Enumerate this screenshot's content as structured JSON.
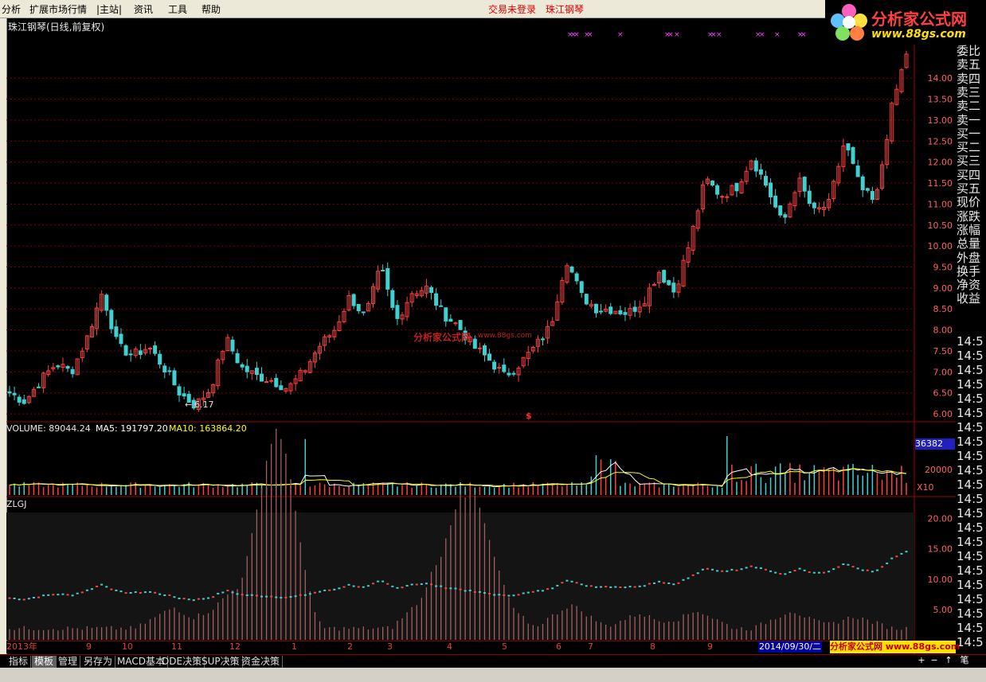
{
  "menu": {
    "items": [
      "分析",
      "扩展市场行情",
      "|主站|",
      "资讯",
      "工具",
      "帮助"
    ],
    "status_login": "交易未登录",
    "status_stock": "珠江钢琴"
  },
  "logo": {
    "text": "分析家公式网",
    "url": "www.88gs.com"
  },
  "chart_title": "珠江钢琴(日线,前复权)",
  "watermark": {
    "brand": "分析家公式网",
    "url": ".www.88gs.com"
  },
  "low_marker": "6.17",
  "signal_marker": "$",
  "volume_legend": {
    "vol_label": "VOLUME: 89044.24",
    "ma5_label": "MA5: 191797.20",
    "ma10_label": "MA10: 163864.20"
  },
  "volume_box": "36382",
  "volume_scale": "X10",
  "zlgj_label": "ZLGJ",
  "right_panel": {
    "labels": [
      "委比",
      "卖五",
      "卖四",
      "卖三",
      "卖二",
      "卖一",
      "买一",
      "买二",
      "买三",
      "买四",
      "买五",
      "现价",
      "涨跌",
      "涨幅",
      "总量",
      "外盘",
      "换手",
      "净资",
      "收益"
    ],
    "repeat_label": "14:5"
  },
  "date_axis": {
    "labels": [
      "2013年",
      "9",
      "10",
      "11",
      "12",
      "1",
      "2",
      "3",
      "4",
      "5",
      "6",
      "7",
      "8",
      "9"
    ],
    "current_date": "2014/09/30/二"
  },
  "mini_logo": "分析家公式网 www.88gs.com",
  "bottom_tabs": [
    "指标",
    "模板",
    "管理",
    "另存为",
    "MACD基本",
    "DDE决策",
    "SUP决策",
    "资金决策"
  ],
  "bottom_active": "模板",
  "nav_buttons": [
    "+",
    "−",
    "↑",
    "笔"
  ],
  "colors": {
    "up": "#ff4040",
    "down": "#40d0d0",
    "grid": "#800000",
    "axis_text": "#ff6060",
    "ma5": "#ffffff",
    "ma10": "#ffff00",
    "zlgj_bg": "#141414",
    "zlgj_bar": "#a06060"
  },
  "chart_data": [
    {
      "type": "candlestick",
      "title": "珠江钢琴(日线,前复权)",
      "y_ticks": [
        6.0,
        6.5,
        7.0,
        7.5,
        8.0,
        8.5,
        9.0,
        9.5,
        10.0,
        10.5,
        11.0,
        11.5,
        12.0,
        12.5,
        13.0,
        13.5,
        14.0
      ],
      "ylim": [
        5.85,
        14.8
      ],
      "anchor_closes": [
        6.5,
        6.3,
        6.8,
        7.2,
        7.0,
        7.8,
        8.9,
        7.6,
        7.4,
        7.6,
        7.1,
        6.5,
        6.2,
        6.6,
        7.8,
        7.1,
        6.9,
        6.8,
        6.6,
        7.0,
        7.6,
        8.0,
        8.8,
        8.3,
        9.5,
        8.2,
        8.9,
        9.0,
        8.4,
        8.1,
        7.6,
        7.3,
        6.9,
        7.2,
        7.6,
        8.1,
        9.7,
        8.8,
        8.5,
        8.5,
        8.4,
        8.7,
        9.4,
        8.9,
        10.1,
        11.6,
        11.2,
        11.4,
        12.1,
        11.4,
        10.5,
        11.6,
        10.8,
        11.0,
        12.5,
        11.4,
        11.0,
        13.2,
        14.6
      ],
      "low_label": 6.17
    },
    {
      "type": "bar",
      "title": "VOLUME",
      "y_ticks": [
        20000
      ],
      "current": 89044.24,
      "ma5": 191797.2,
      "ma10": 163864.2,
      "scale": "X10"
    },
    {
      "type": "bar",
      "title": "ZLGJ",
      "y_ticks": [
        5.0,
        10.0,
        15.0,
        20.0
      ],
      "ylim": [
        0,
        21
      ]
    }
  ]
}
